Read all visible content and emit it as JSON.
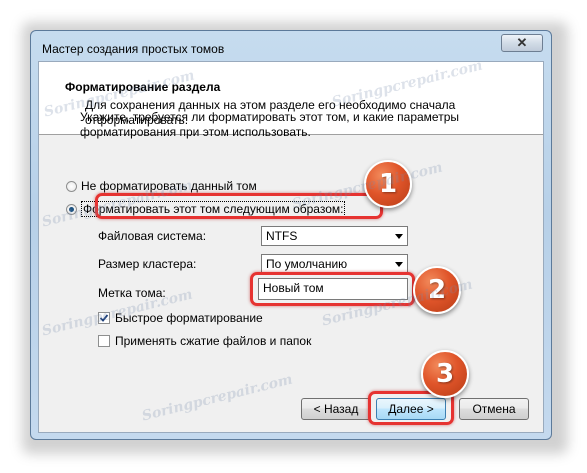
{
  "window": {
    "title": "Мастер создания простых томов",
    "close_glyph": "✕"
  },
  "header": {
    "title": "Форматирование раздела",
    "description": "Для сохранения данных на этом разделе его необходимо сначала отформатировать."
  },
  "instruction": "Укажите, требуется ли форматировать этот том, и какие параметры форматирования при этом использовать.",
  "options": {
    "no_format": {
      "label": "Не форматировать данный том",
      "checked": false
    },
    "format": {
      "label": "Форматировать этот том следующим образом:",
      "checked": true
    }
  },
  "fields": {
    "filesystem": {
      "label": "Файловая система:",
      "value": "NTFS"
    },
    "cluster": {
      "label": "Размер кластера:",
      "value": "По умолчанию"
    },
    "volume_label": {
      "label": "Метка тома:",
      "value": "Новый том"
    }
  },
  "checkboxes": {
    "quick_format": {
      "label": "Быстрое форматирование",
      "checked": true
    },
    "compression": {
      "label": "Применять сжатие файлов и папок",
      "checked": false
    }
  },
  "buttons": {
    "back": "< Назад",
    "next": "Далее >",
    "cancel": "Отмена"
  },
  "badges": [
    "1",
    "2",
    "3"
  ],
  "watermark": "Soringpcrepair.com",
  "colors": {
    "highlight": "#e63331",
    "badge": "#e0552a"
  }
}
